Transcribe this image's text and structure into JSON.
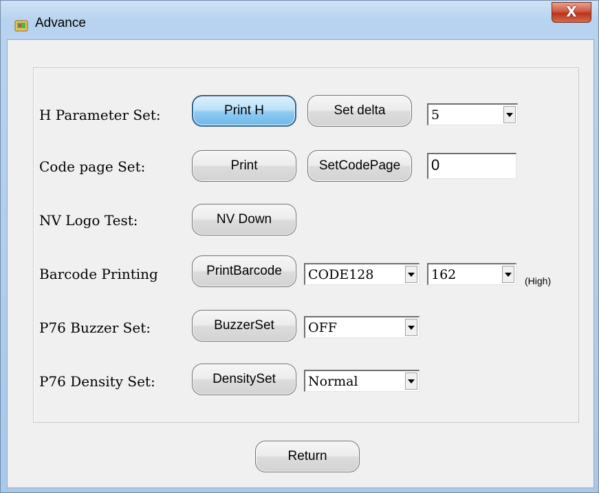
{
  "window": {
    "title": "Advance",
    "close_label": "X"
  },
  "rows": {
    "h_param": {
      "label": "H Parameter Set:",
      "print_btn": "Print H",
      "set_btn": "Set delta",
      "delta_value": "5"
    },
    "code_page": {
      "label": "Code page Set:",
      "print_btn": "Print",
      "set_btn": "SetCodePage",
      "code_value": "0"
    },
    "nv_logo": {
      "label": "NV Logo Test:",
      "btn": "NV Down"
    },
    "barcode": {
      "label": "Barcode Printing",
      "btn": "PrintBarcode",
      "type_value": "CODE128",
      "height_value": "162",
      "height_unit": "(High)"
    },
    "buzzer": {
      "label": "P76 Buzzer Set:",
      "btn": "BuzzerSet",
      "value": "OFF"
    },
    "density": {
      "label": "P76 Density Set:",
      "btn": "DensitySet",
      "value": "Normal"
    }
  },
  "footer": {
    "return_btn": "Return"
  },
  "colors": {
    "active_button": "#8fcbf1",
    "close_button": "#c8452b"
  },
  "icons": {
    "app": "printer-app-icon",
    "close": "close-icon",
    "dropdown": "chevron-down-icon"
  }
}
